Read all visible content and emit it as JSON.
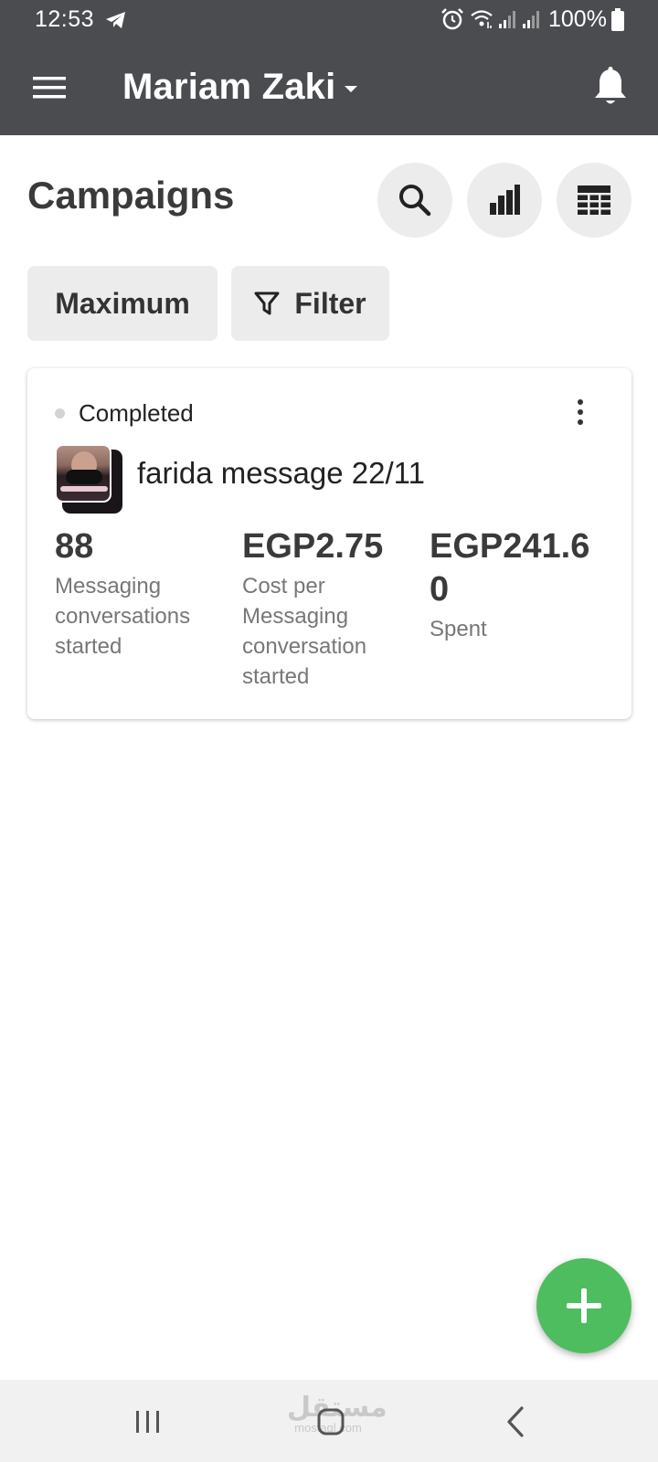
{
  "status_bar": {
    "time": "12:53",
    "battery": "100%",
    "icons": [
      "telegram-icon",
      "alarm-icon",
      "wifi-icon",
      "signal-icon",
      "signal-icon",
      "battery-icon"
    ]
  },
  "app_bar": {
    "account_name": "Mariam Zaki",
    "icons": [
      "menu-icon",
      "caret-down-icon",
      "bell-icon"
    ]
  },
  "header": {
    "title": "Campaigns",
    "actions": [
      "search-icon",
      "bar-chart-icon",
      "table-icon"
    ]
  },
  "chips": {
    "maximum_label": "Maximum",
    "filter_label": "Filter"
  },
  "campaign": {
    "status": "Completed",
    "name": "farida message 22/11",
    "metrics": [
      {
        "value": "88",
        "label": "Messaging conversations started"
      },
      {
        "value": "EGP2.75",
        "label": "Cost per Messaging conversation started"
      },
      {
        "value": "EGP241.60",
        "label": "Spent"
      }
    ]
  },
  "watermark": {
    "main": "مستقل",
    "sub": "mostaql.com"
  },
  "colors": {
    "app_bar": "#4a4c50",
    "fab": "#4dbd5f",
    "chip_bg": "#ececec",
    "status_dot": "#d4d4d4",
    "nav_bar": "#f1f1f1"
  }
}
